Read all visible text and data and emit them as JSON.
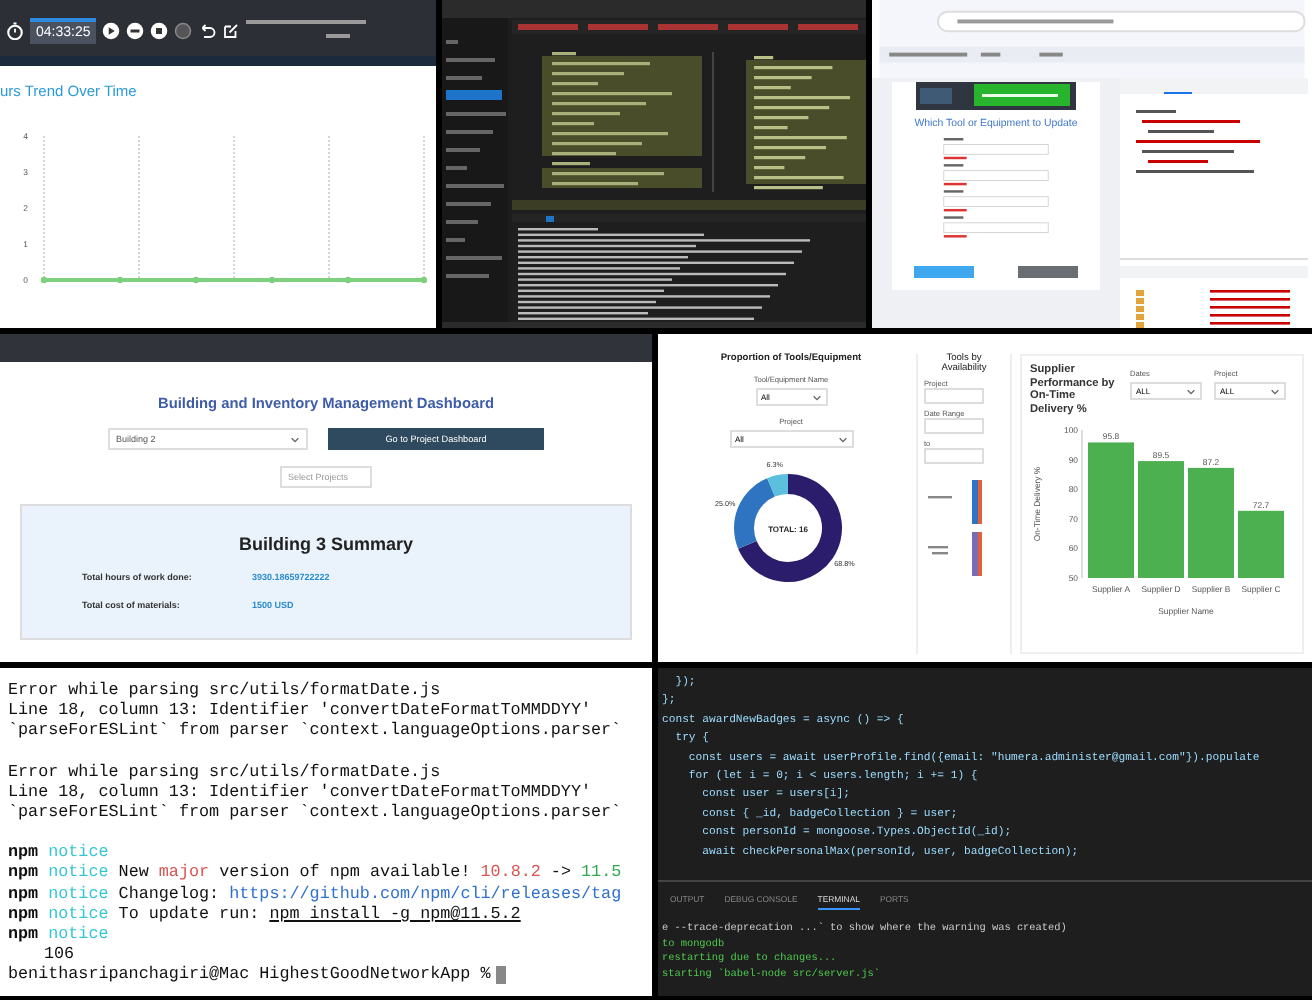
{
  "timer_panel": {
    "timer": "04:33:25",
    "chart_title": "urs Trend Over Time",
    "y_axis_labels": [
      "4",
      "3",
      "2",
      "1",
      "0"
    ]
  },
  "form_panel": {
    "form_title": "Which Tool or Equipment to Update"
  },
  "dashboard_panel": {
    "title": "Building and Inventory Management Dashboard",
    "building_select": {
      "value": "Building 2"
    },
    "project_button": "Go to Project Dashboard",
    "projects_select": {
      "placeholder": "Select Projects"
    },
    "summary": {
      "title": "Building 3 Summary",
      "rows": [
        {
          "label": "Total hours of work done:",
          "value": "3930.18659722222"
        },
        {
          "label": "Total cost of materials:",
          "value": "1500 USD"
        }
      ]
    }
  },
  "reports_panel": {
    "proportion": {
      "title": "Proportion of Tools/Equipment",
      "name_filter": {
        "label": "Tool/Equipment Name",
        "value": "All"
      },
      "project_filter": {
        "label": "Project",
        "value": "All"
      },
      "chart_data": {
        "type": "donut",
        "values": [
          68.8,
          25.0,
          6.3
        ],
        "colors": [
          "#2b1d6b",
          "#2f74c0",
          "#5bc0de"
        ],
        "value_labels": [
          "68.8%",
          "25.0%",
          "6.3%"
        ],
        "annotations": [
          "TOTAL: 16"
        ]
      }
    },
    "availability": {
      "title": "Tools by Availability",
      "project_label": "Project",
      "date_label": "Date Range",
      "to_label": "to"
    },
    "supplier": {
      "title": "Supplier Performance by On-Time Delivery %",
      "filters": [
        {
          "label": "Dates",
          "value": "ALL"
        },
        {
          "label": "Project",
          "value": "ALL"
        }
      ],
      "chart_data": {
        "type": "bar",
        "xlabel": "Supplier Name",
        "ylabel": "On-Time Delivery %",
        "categories": [
          "Supplier A",
          "Supplier D",
          "Supplier B",
          "Supplier C"
        ],
        "ylim": [
          50,
          100
        ],
        "yticks": [
          50,
          60,
          70,
          80,
          90,
          100
        ],
        "series": [
          {
            "color": "#4caf50",
            "values": [
              95.8,
              89.5,
              87.2,
              72.7
            ]
          }
        ],
        "data_labels": true
      }
    }
  },
  "terminal": {
    "messages": [
      {
        "lines": [
          "Error while parsing src/utils/formatDate.js",
          "Line 18, column 13: Identifier 'convertDateFormatToMMDDYY'",
          "`parseForESLint` from parser `context.languageOptions.parser`"
        ]
      },
      {
        "lines": [
          "Error while parsing src/utils/formatDate.js",
          "Line 18, column 13: Identifier 'convertDateFormatToMMDDYY'",
          "`parseForESLint` from parser `context.languageOptions.parser`"
        ]
      }
    ],
    "npm_lines": [
      {
        "name": "npm",
        "level": "notice"
      },
      {
        "name": "npm",
        "level": "notice",
        "parts": [
          {
            "kind": "plain",
            "text": "New "
          },
          {
            "kind": "warn",
            "text": "major"
          },
          {
            "kind": "plain",
            "text": " version of npm available! "
          },
          {
            "kind": "warn",
            "text": "10.8.2"
          },
          {
            "kind": "plain",
            "text": " -> "
          },
          {
            "kind": "good",
            "text": "11.5"
          }
        ]
      },
      {
        "name": "npm",
        "level": "notice",
        "parts": [
          {
            "kind": "plain",
            "text": "Changelog: "
          },
          {
            "kind": "link",
            "text": "https://github.com/npm/cli/releases/tag"
          }
        ]
      },
      {
        "name": "npm",
        "level": "notice",
        "parts": [
          {
            "kind": "plain",
            "text": "To update run: "
          },
          {
            "kind": "command",
            "text": "npm install -g npm@11.5.2"
          }
        ]
      },
      {
        "name": "npm",
        "level": "notice"
      }
    ],
    "output": "106",
    "prompt": "benithasripanchagiri@Mac HighestGoodNetworkApp %"
  },
  "editor": {
    "code_lines": [
      "  });",
      "};",
      "const awardNewBadges = async () => {",
      "  try {",
      "    const users = await userProfile.find({email: \"humera.administer@gmail.com\"}).populate",
      "    for (let i = 0; i < users.length; i += 1) {",
      "      const user = users[i];",
      "      const { _id, badgeCollection } = user;",
      "      const personId = mongoose.Types.ObjectId(_id);",
      "      await checkPersonalMax(personId, user, badgeCollection);"
    ],
    "tabs": [
      {
        "label": "OUTPUT",
        "selected": false
      },
      {
        "label": "DEBUG CONSOLE",
        "selected": false
      },
      {
        "label": "TERMINAL",
        "selected": true
      },
      {
        "label": "PORTS",
        "selected": false
      }
    ],
    "terminal_lines": [
      {
        "kind": "plain",
        "text": "e --trace-deprecation ...` to show where the warning was created)"
      },
      {
        "kind": "success",
        "text": "to mongodb"
      },
      {
        "kind": "success",
        "text": "restarting due to changes..."
      },
      {
        "kind": "success",
        "text": "starting `babel-node src/server.js`"
      }
    ]
  }
}
